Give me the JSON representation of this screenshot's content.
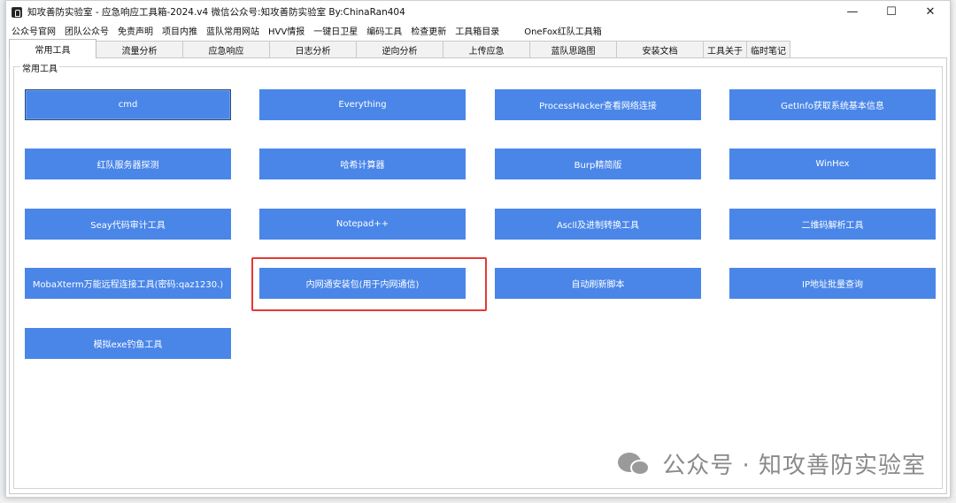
{
  "window": {
    "title": "知攻善防实验室 - 应急响应工具箱-2024.v4    微信公众号:知攻善防实验室    By:ChinaRan404",
    "controls": {
      "minimize": "—",
      "maximize": "☐",
      "close": "✕"
    }
  },
  "menu": [
    "公众号官网",
    "团队公众号",
    "免责声明",
    "项目内推",
    "蓝队常用网站",
    "HVV情报",
    "一键日卫星",
    "编码工具",
    "检查更新",
    "工具箱目录",
    "OneFox红队工具箱"
  ],
  "tabs": [
    {
      "label": "常用工具",
      "active": true
    },
    {
      "label": "流量分析",
      "active": false
    },
    {
      "label": "应急响应",
      "active": false
    },
    {
      "label": "日志分析",
      "active": false
    },
    {
      "label": "逆向分析",
      "active": false
    },
    {
      "label": "上传应急",
      "active": false
    },
    {
      "label": "蓝队思路图",
      "active": false
    },
    {
      "label": "安装文档",
      "active": false
    },
    {
      "label": "工具关于",
      "active": false
    },
    {
      "label": "临时笔记",
      "active": false
    }
  ],
  "group": {
    "label": "常用工具",
    "buttons": [
      [
        "cmd",
        "Everything",
        "ProcessHacker查看网络连接",
        "GetInfo获取系统基本信息"
      ],
      [
        "红队服务器探测",
        "哈希计算器",
        "Burp精简版",
        "WinHex"
      ],
      [
        "Seay代码审计工具",
        "Notepad++",
        "Ascll及进制转换工具",
        "二维码解析工具"
      ],
      [
        "MobaXterm万能远程连接工具(密码:qaz1230.)",
        "内网通安装包(用于内网通信)",
        "自动刷新脚本",
        "IP地址批量查询"
      ],
      [
        "模拟exe钓鱼工具"
      ]
    ]
  },
  "watermark": {
    "text": "公众号 · 知攻善防实验室",
    "icon": "wechat-icon"
  },
  "colors": {
    "button": "#4a86e8",
    "highlight": "#e53935",
    "watermark": "#8a8a8a"
  }
}
